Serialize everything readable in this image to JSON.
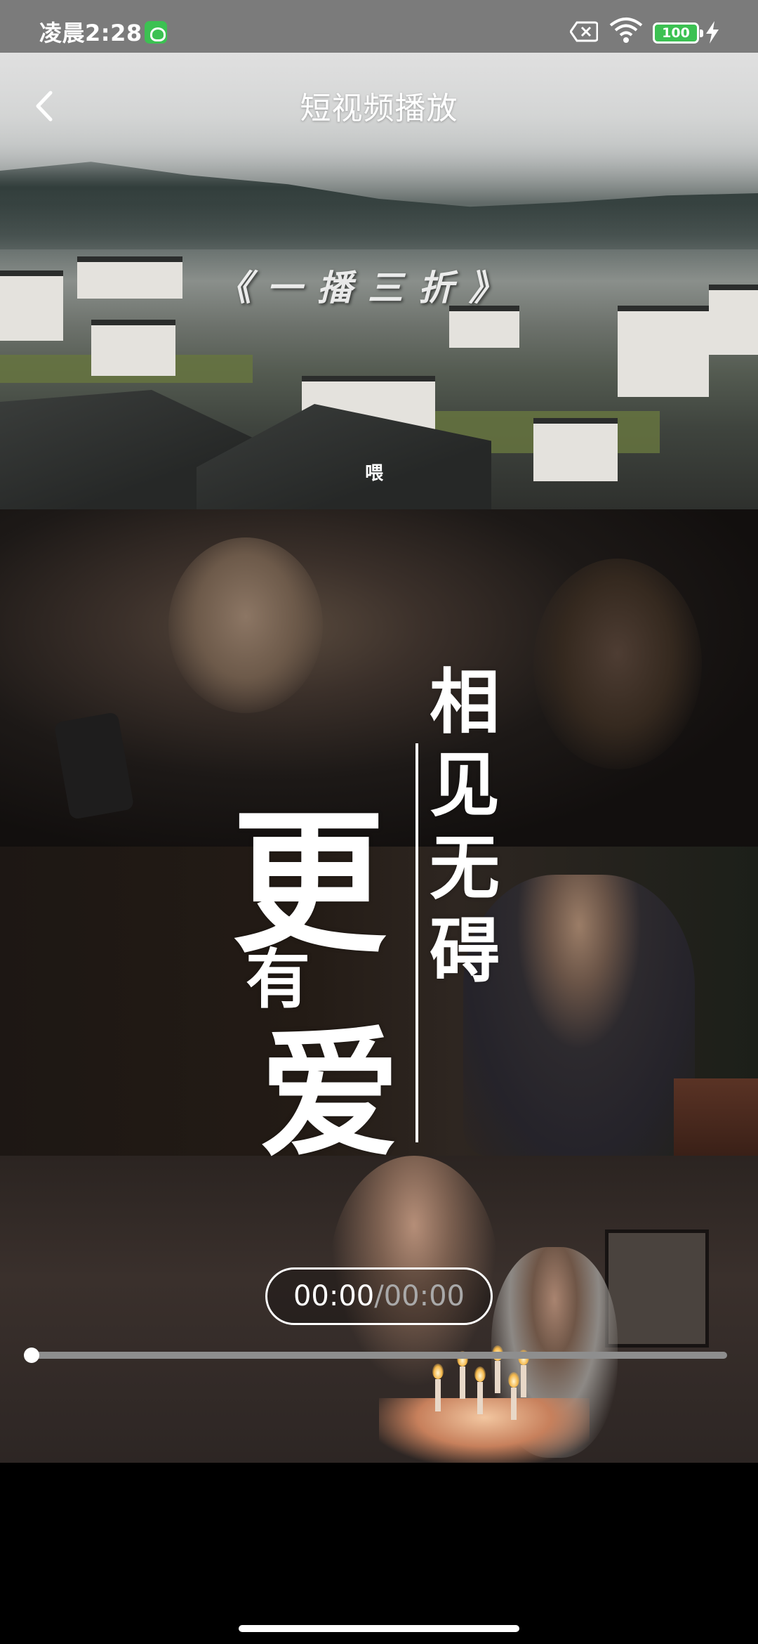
{
  "status_bar": {
    "time": "凌晨2:28",
    "battery_level": "100",
    "icons": [
      "app-notification-icon",
      "sim-off-icon",
      "wifi-icon",
      "battery-icon",
      "charging-icon"
    ]
  },
  "header": {
    "title": "短视频播放",
    "back_icon": "chevron-left-icon"
  },
  "video": {
    "overlay_title": "《一播三折》",
    "overlay_subtitle": "喂",
    "calligraphy": {
      "left_top": "更",
      "left_mid": "有",
      "left_bottom": "爱",
      "right_column": "相见无碍"
    }
  },
  "player": {
    "current_time": "00:00",
    "separator": "/",
    "total_time": "00:00",
    "progress": 0
  },
  "colors": {
    "status_bar_bg": "#7b7b7b",
    "accent_green": "#3cc152",
    "progress_track": "#8e8e8e"
  }
}
